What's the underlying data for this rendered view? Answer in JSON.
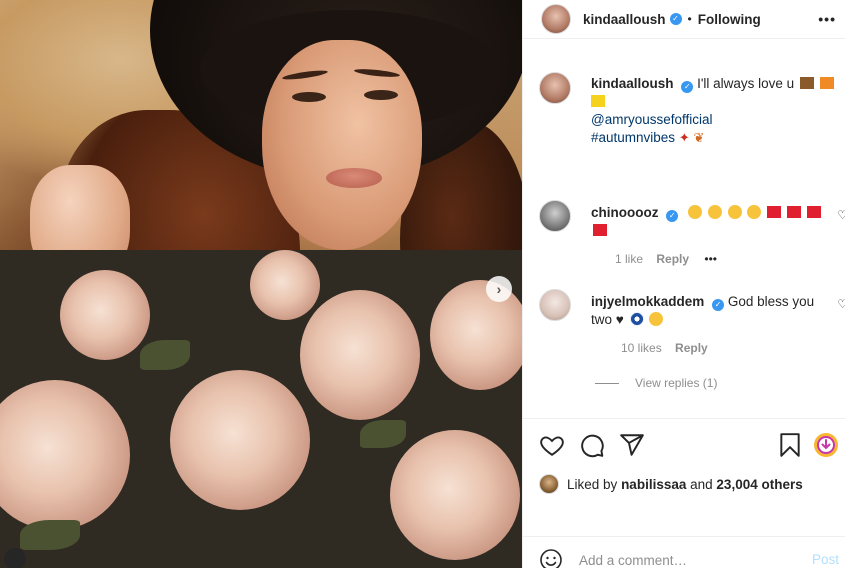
{
  "post": {
    "username": "kindaalloush",
    "verified_mark": "✓",
    "separator": "•",
    "follow_status": "Following",
    "more_icon": "•••",
    "next_icon": "›"
  },
  "caption": {
    "username": "kindaalloush",
    "text": "I'll always love u",
    "mention": "@amryoussefofficial",
    "hashtag": "#autumnvibes"
  },
  "comments": [
    {
      "username": "chinooooz",
      "likes": "1 like",
      "reply": "Reply",
      "more": "•••"
    },
    {
      "username": "injyelmokkaddem",
      "text": "God bless you two ♥",
      "likes": "10 likes",
      "reply": "Reply",
      "view_replies": "View replies (1)"
    }
  ],
  "liked_by": {
    "prefix": "Liked by",
    "user": "nabilissaa",
    "and": "and",
    "others": "23,004 others"
  },
  "comment_box": {
    "placeholder": "Add a comment…",
    "post_label": "Post"
  },
  "colors": {
    "link": "#00376b",
    "verified": "#3897f0",
    "post_disabled": "#b2dffc"
  }
}
